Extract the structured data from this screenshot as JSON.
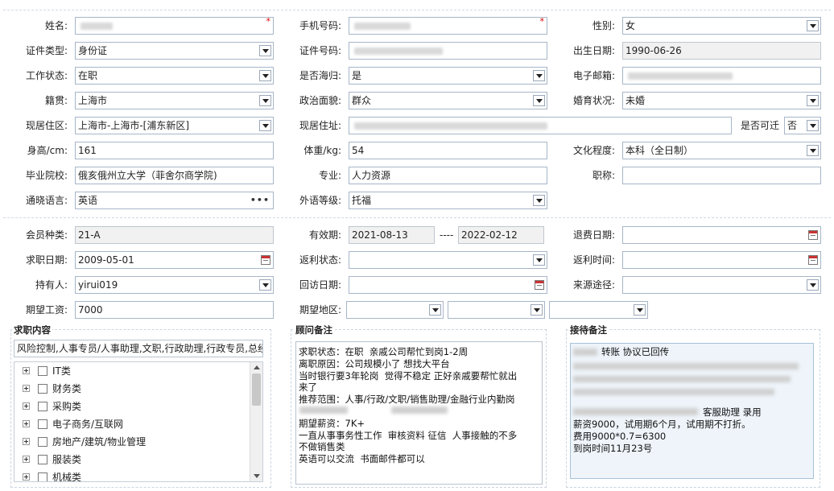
{
  "row1": {
    "name_label": "姓名:",
    "phone_label": "手机号码:",
    "gender_label": "性别:",
    "gender_value": "女",
    "required_mark": "*"
  },
  "row2": {
    "idtype_label": "证件类型:",
    "idtype_value": "身份证",
    "idno_label": "证件号码:",
    "birth_label": "出生日期:",
    "birth_value": "1990-06-26"
  },
  "row3": {
    "work_label": "工作状态:",
    "work_value": "在职",
    "overseas_label": "是否海归:",
    "overseas_value": "是",
    "email_label": "电子邮箱:"
  },
  "row4": {
    "native_label": "籍贯:",
    "native_value": "上海市",
    "political_label": "政治面貌:",
    "political_value": "群众",
    "marriage_label": "婚育状况:",
    "marriage_value": "未婚"
  },
  "row5": {
    "area_label": "现居住区:",
    "area_value": "上海市-上海市-[浦东新区]",
    "addr_label": "现居住址:",
    "relocate_label": "是否可迁",
    "relocate_value": "否"
  },
  "row6": {
    "height_label": "身高/cm:",
    "height_value": "161",
    "weight_label": "体重/kg:",
    "weight_value": "54",
    "edu_label": "文化程度:",
    "edu_value": "本科（全日制）"
  },
  "row7": {
    "school_label": "毕业院校:",
    "school_value": "俄亥俄州立大学（菲舍尔商学院)",
    "major_label": "专业:",
    "major_value": "人力资源",
    "title_label": "职称:"
  },
  "row8": {
    "lang_label": "通晓语言:",
    "lang_value": "英语",
    "lang_more": "•••",
    "level_label": "外语等级:",
    "level_value": "托福"
  },
  "row9": {
    "member_label": "会员种类:",
    "member_value": "21-A",
    "valid_label": "有效期:",
    "valid_start": "2021-08-13",
    "valid_dash": "----",
    "valid_end": "2022-02-12",
    "refund_label": "退费日期:"
  },
  "row10": {
    "apply_label": "求职日期:",
    "apply_value": "2009-05-01",
    "rebate_status_label": "返利状态:",
    "rebate_time_label": "返利时间:"
  },
  "row11": {
    "holder_label": "持有人:",
    "holder_value": "yirui019",
    "visit_label": "回访日期:",
    "source_label": "来源途径:"
  },
  "row12": {
    "salary_label": "期望工资:",
    "salary_value": "7000",
    "region_label": "期望地区:"
  },
  "job_panel": {
    "title": "求职内容",
    "summary": "风险控制,人事专员/人事助理,文职,行政助理,行政专员,总经",
    "tree": [
      {
        "label": "IT类"
      },
      {
        "label": "财务类"
      },
      {
        "label": "采购类"
      },
      {
        "label": "电子商务/互联网"
      },
      {
        "label": "房地产/建筑/物业管理"
      },
      {
        "label": "服装类"
      },
      {
        "label": "机械类"
      }
    ]
  },
  "advisor_panel": {
    "title": "顾问备注",
    "note": "求职状态：在职  亲戚公司帮忙到岗1-2周\n离职原因：公司规模小了 想找大平台\n当时银行要3年轮岗  觉得不稳定 正好亲戚要帮忙就出\n来了\n推荐范围：人事/行政/文职/销售助理/金融行业内勤岗\n\n期望薪资：7K+\n一直从事事务性工作  审核资料 征信  人事接触的不多\n不做销售类\n英语可以交流  书面邮件都可以"
  },
  "reception_panel": {
    "title": "接待备注",
    "line_top": "转账 协议已回传",
    "line_mid": "客服助理 录用",
    "line_salary": "薪资9000，试用期6个月，试用期不打折。",
    "line_fee": "费用9000*0.7=6300",
    "line_date": "到岗时间11月23号"
  },
  "colors": {
    "border": "#a7b6c8",
    "readonly_bg": "#f1f1f1",
    "required": "#dd0000",
    "section_separator": "#cfd8e3"
  }
}
